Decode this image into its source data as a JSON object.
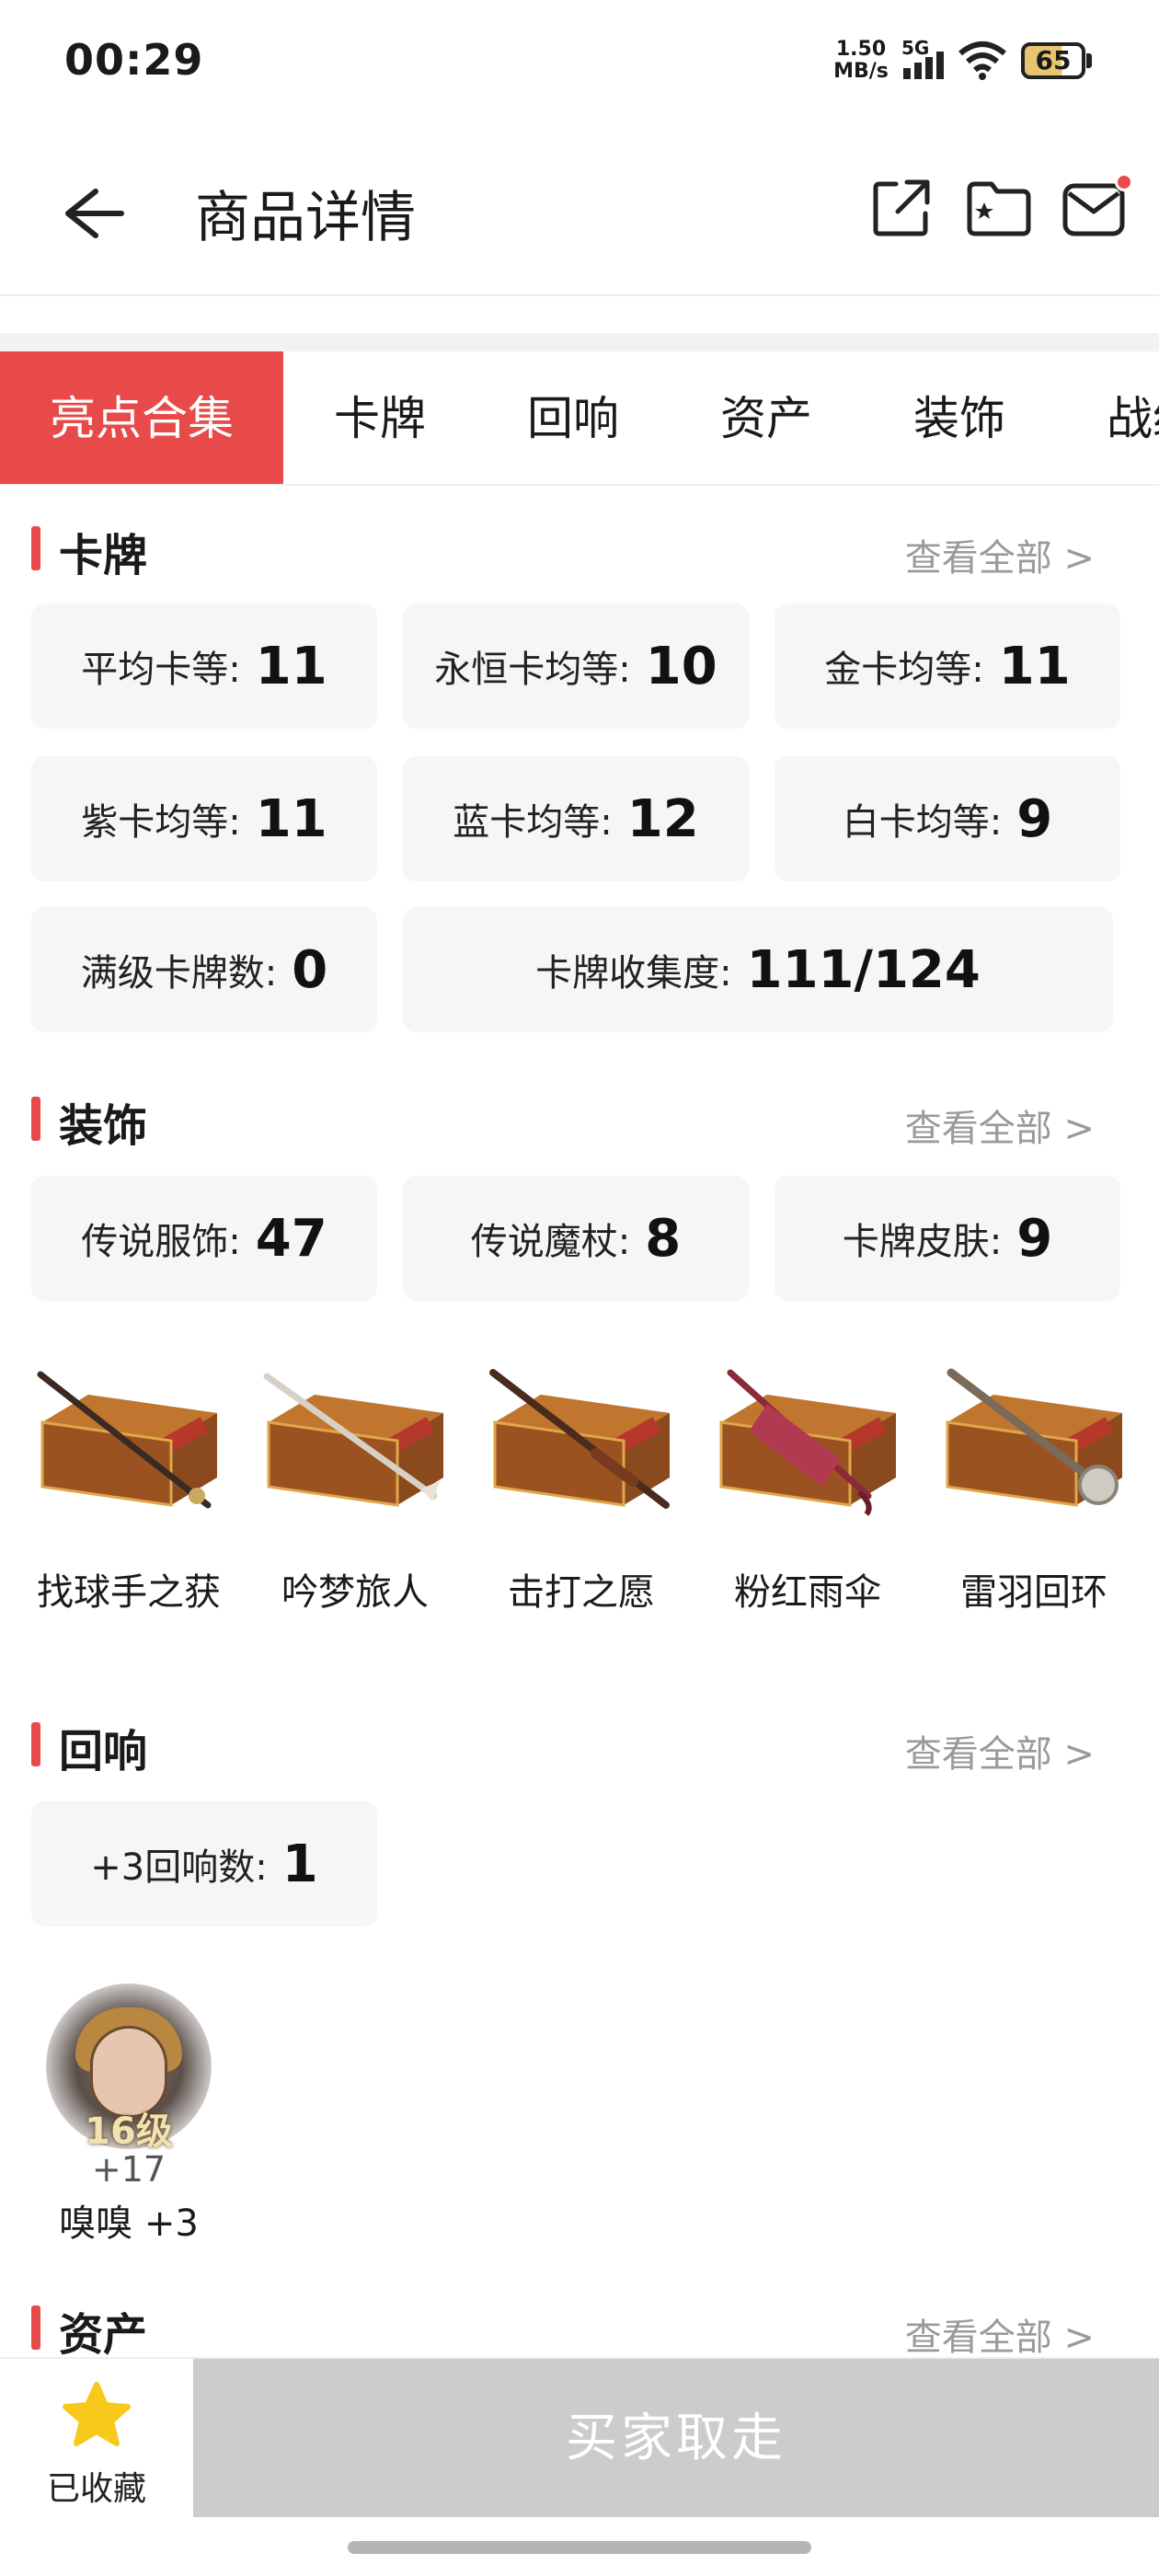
{
  "status": {
    "time": "00:29",
    "speed_value": "1.50",
    "speed_unit": "MB/s",
    "network": "5G",
    "battery": "65"
  },
  "header": {
    "title": "商品详情",
    "icons": [
      "back-arrow-icon",
      "share-icon",
      "folder-star-icon",
      "mail-icon"
    ]
  },
  "tabs": [
    "亮点合集",
    "卡牌",
    "回响",
    "资产",
    "装饰",
    "战绩"
  ],
  "sections": {
    "cards": {
      "title": "卡牌",
      "more": "查看全部 >",
      "stats": [
        {
          "label": "平均卡等:",
          "value": "11"
        },
        {
          "label": "永恒卡均等:",
          "value": "10"
        },
        {
          "label": "金卡均等:",
          "value": "11"
        },
        {
          "label": "紫卡均等:",
          "value": "11"
        },
        {
          "label": "蓝卡均等:",
          "value": "12"
        },
        {
          "label": "白卡均等:",
          "value": "9"
        },
        {
          "label": "满级卡牌数:",
          "value": "0"
        },
        {
          "label": "卡牌收集度:",
          "value": "111/124"
        }
      ]
    },
    "decor": {
      "title": "装饰",
      "more": "查看全部 >",
      "stats": [
        {
          "label": "传说服饰:",
          "value": "47"
        },
        {
          "label": "传说魔杖:",
          "value": "8"
        },
        {
          "label": "卡牌皮肤:",
          "value": "9"
        }
      ],
      "wands": [
        {
          "name": "找球手之获"
        },
        {
          "name": "吟梦旅人"
        },
        {
          "name": "击打之愿"
        },
        {
          "name": "粉红雨伞"
        },
        {
          "name": "雷羽回环"
        }
      ]
    },
    "echo": {
      "title": "回响",
      "more": "查看全部 >",
      "stats": [
        {
          "label": "+3回响数:",
          "value": "1"
        }
      ],
      "items": [
        {
          "level": "16级",
          "bonus": "+17",
          "name": "嗅嗅 +3"
        }
      ]
    },
    "assets": {
      "title": "资产",
      "more": "查看全部 >"
    }
  },
  "bottom": {
    "favorite_label": "已收藏",
    "buy_label": "买家取走"
  },
  "colors": {
    "accent": "#e84a4a",
    "card_bg": "#f6f6f6",
    "button_disabled": "#cccccc",
    "star": "#f7c91c"
  }
}
